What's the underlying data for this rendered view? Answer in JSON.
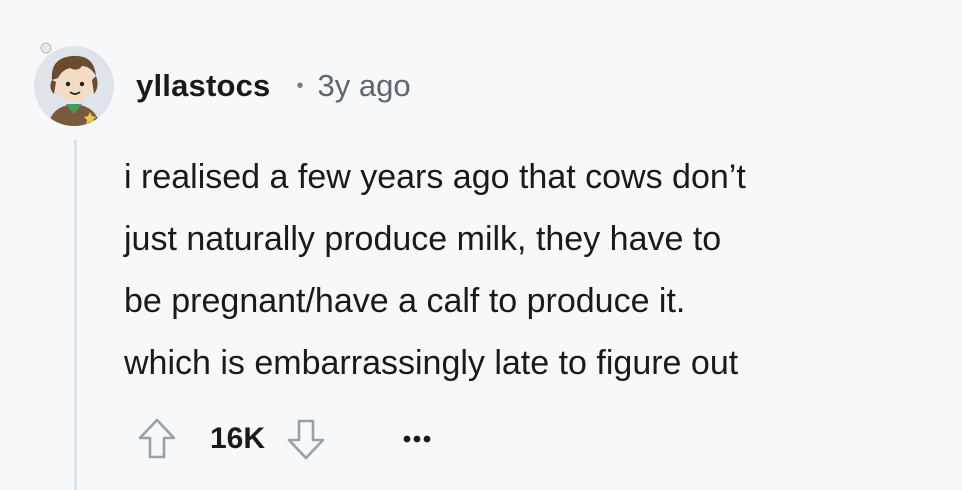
{
  "comment": {
    "username": "yllastocs",
    "separator": "•",
    "age": "3y ago",
    "lines": [
      "i realised a few years ago that cows don’t",
      "just naturally produce milk, they have to",
      "be pregnant/have a calf to produce it.",
      "which is embarrassingly late to figure out"
    ],
    "score": "16K"
  },
  "icons": {
    "avatar": "user-avatar-icon",
    "upvote": "arrow-up-icon",
    "downvote": "arrow-down-icon",
    "more": "more-options-icon"
  },
  "colors": {
    "background": "#f7f8fa",
    "text": "#1a1a1b",
    "muted": "#5c6670",
    "thread_line": "#dfe3e8",
    "icon_stroke": "#9aa0a6"
  }
}
